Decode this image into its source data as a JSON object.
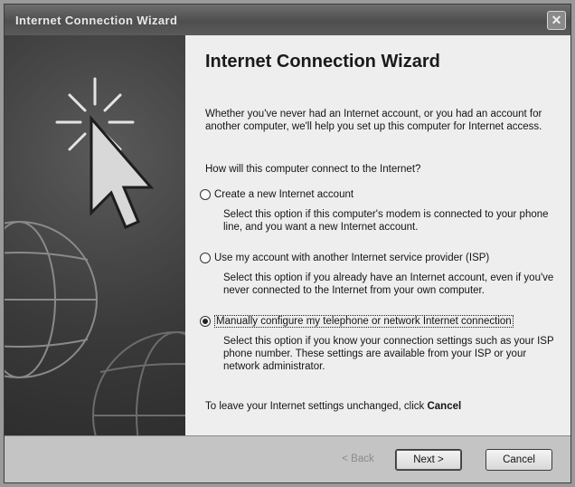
{
  "window": {
    "title": "Internet Connection Wizard",
    "close_glyph": "✕"
  },
  "content": {
    "heading": "Internet Connection Wizard",
    "intro": "Whether you've never had an Internet account, or you had an account for another computer, we'll help you set up this computer for Internet access.",
    "question": "How will this computer connect to the Internet?",
    "options": [
      {
        "label": "Create a new Internet account",
        "description": "Select this option if this computer's modem is connected to your phone line, and you want a new Internet account.",
        "selected": false
      },
      {
        "label": "Use my account with another Internet service provider (ISP)",
        "description": "Select this option if you already have an Internet account, even if you've never connected to the Internet from your own computer.",
        "selected": false
      },
      {
        "label": "Manually configure my telephone or network Internet connection",
        "description": "Select this option if you know your connection settings such as your ISP phone number. These settings are available from your ISP or your network administrator.",
        "selected": true
      }
    ],
    "footer_prefix": "To leave your Internet settings unchanged, click ",
    "footer_emphasis": "Cancel"
  },
  "buttons": {
    "back": "< Back",
    "next": "Next >",
    "cancel": "Cancel"
  },
  "icons": {
    "side_panel": [
      "cursor-arrow-icon",
      "starburst-icon",
      "globe-icon"
    ]
  }
}
